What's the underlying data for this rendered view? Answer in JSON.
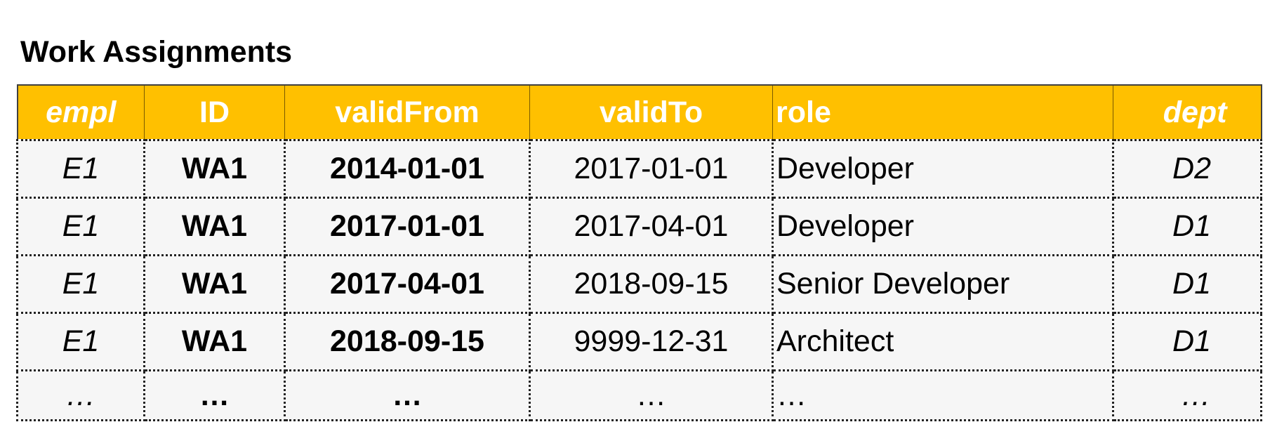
{
  "title": "Work Assignments",
  "table": {
    "headers": {
      "empl": "empl",
      "id": "ID",
      "validFrom": "validFrom",
      "validTo": "validTo",
      "role": "role",
      "dept": "dept"
    },
    "rows": [
      {
        "empl": "E1",
        "id": "WA1",
        "validFrom": "2014-01-01",
        "validTo": "2017-01-01",
        "role": "Developer",
        "dept": "D2"
      },
      {
        "empl": "E1",
        "id": "WA1",
        "validFrom": "2017-01-01",
        "validTo": "2017-04-01",
        "role": "Developer",
        "dept": "D1"
      },
      {
        "empl": "E1",
        "id": "WA1",
        "validFrom": "2017-04-01",
        "validTo": "2018-09-15",
        "role": "Senior Developer",
        "dept": "D1"
      },
      {
        "empl": "E1",
        "id": "WA1",
        "validFrom": "2018-09-15",
        "validTo": "9999-12-31",
        "role": "Architect",
        "dept": "D1"
      },
      {
        "empl": "…",
        "id": "…",
        "validFrom": "…",
        "validTo": "…",
        "role": "…",
        "dept": "…"
      }
    ]
  }
}
